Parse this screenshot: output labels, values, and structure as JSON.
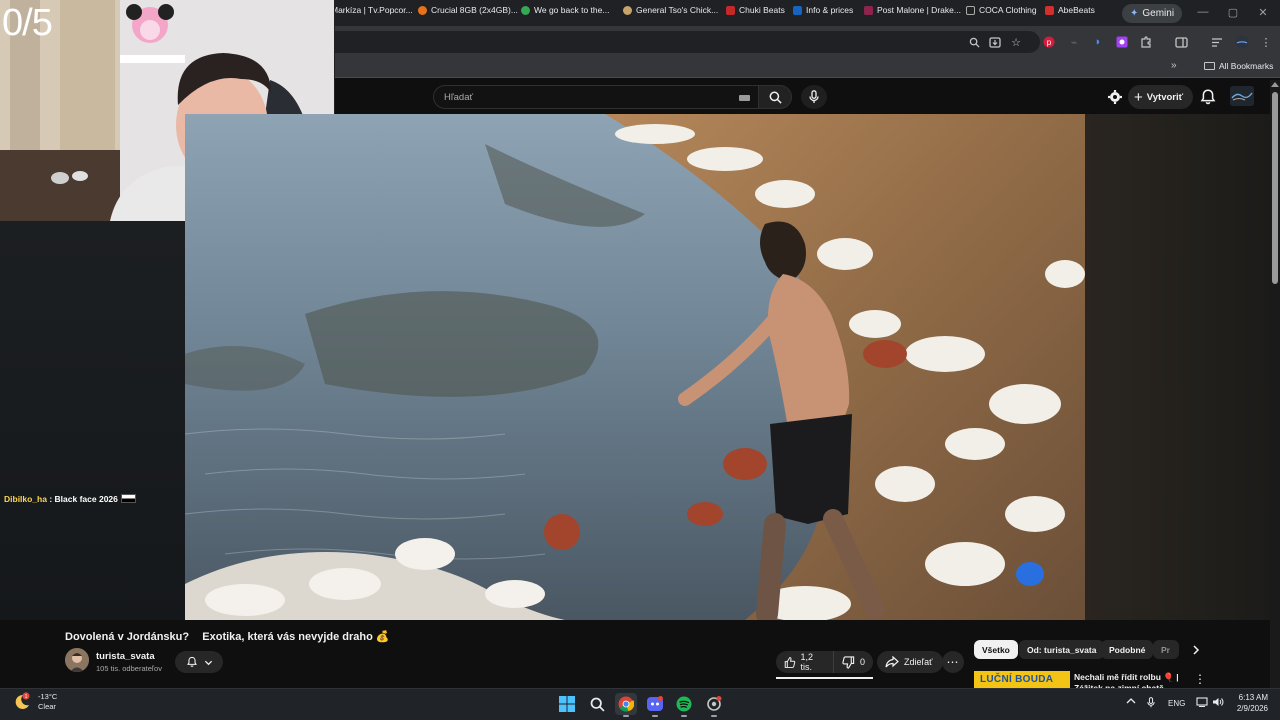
{
  "stream": {
    "counter": "0/5",
    "chat": {
      "user": "Dibilko_ha",
      "separator": " : ",
      "message": "Black face 2026"
    }
  },
  "browser": {
    "gemini_label": "Gemini",
    "bookmarks": [
      {
        "label": "Markíza | Tv.Popcor...",
        "color": "#6b6b6b"
      },
      {
        "label": "Crucial 8GB (2x4GB)...",
        "color": "#e8711a"
      },
      {
        "label": "We go back to the...",
        "color": "#34a853"
      },
      {
        "label": "General Tso's Chick...",
        "color": "#c8a36a"
      },
      {
        "label": "Chuki Beats",
        "color": "#c62828"
      },
      {
        "label": "Info & prices",
        "color": "#1565c0"
      },
      {
        "label": "Post Malone | Drake...",
        "color": "#8e244d"
      },
      {
        "label": "COCA Clothing",
        "color": "#222222"
      },
      {
        "label": "AbeBeats",
        "color": "#d32f2f"
      }
    ],
    "all_bookmarks": "All Bookmarks"
  },
  "youtube": {
    "search_placeholder": "Hľadať",
    "create_label": "Vytvoriť",
    "video": {
      "title": "Dovolená v Jordánsku?ㅤ Exotika, která vás nevyjde draho 💰",
      "channel": "turista_svata",
      "subscribers": "105 tis. odberateľov",
      "likes": "1,2 tis.",
      "dislikes": "0",
      "share_label": "Zdieľať"
    },
    "chips": [
      "Všetko",
      "Od: turista_svata",
      "Podobné",
      "Pr"
    ],
    "recommendation": {
      "thumb_text": "LUČNÍ BOUDA",
      "title": "Nechali mě řídit rolbu 🎈 | Zážitek na zimní chatě"
    }
  },
  "taskbar": {
    "weather_temp": "-13°C",
    "weather_desc": "Clear",
    "weather_badge": "1",
    "lang": "ENG",
    "time": "6:13 AM",
    "date": "2/9/2026"
  },
  "colors": {
    "yt_bg": "#0f0f0f",
    "chip_active": "#f1f1f1",
    "accent_red": "#ff0000",
    "chrome_toolbar": "#35363a"
  }
}
